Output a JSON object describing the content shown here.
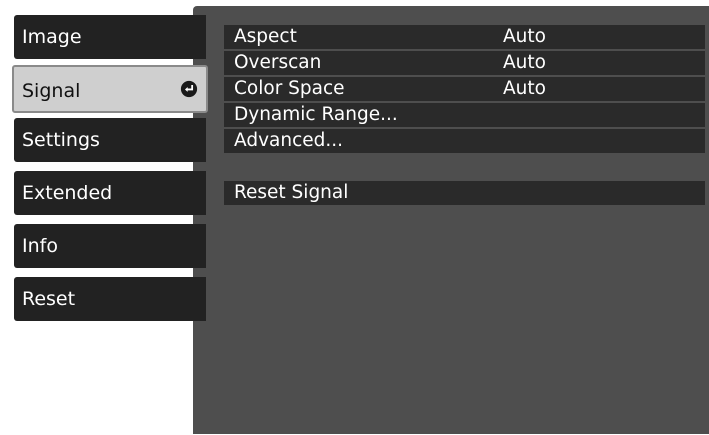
{
  "tabs": [
    {
      "label": "Image"
    },
    {
      "label": "Signal"
    },
    {
      "label": "Settings"
    },
    {
      "label": "Extended"
    },
    {
      "label": "Info"
    },
    {
      "label": "Reset"
    }
  ],
  "menu": {
    "aspect": {
      "label": "Aspect",
      "value": "Auto"
    },
    "overscan": {
      "label": "Overscan",
      "value": "Auto"
    },
    "color_space": {
      "label": "Color Space",
      "value": "Auto"
    },
    "dynamic_range": {
      "label": "Dynamic Range..."
    },
    "advanced": {
      "label": "Advanced..."
    },
    "reset_signal": {
      "label": "Reset Signal"
    }
  },
  "icons": {
    "active_tab_indicator": "enter-icon"
  },
  "colors": {
    "panel_bg": "#4e4e4e",
    "row_bg": "#2a2a2a",
    "tab_bg": "#222222",
    "active_tab_bg": "#cfcfcf"
  }
}
